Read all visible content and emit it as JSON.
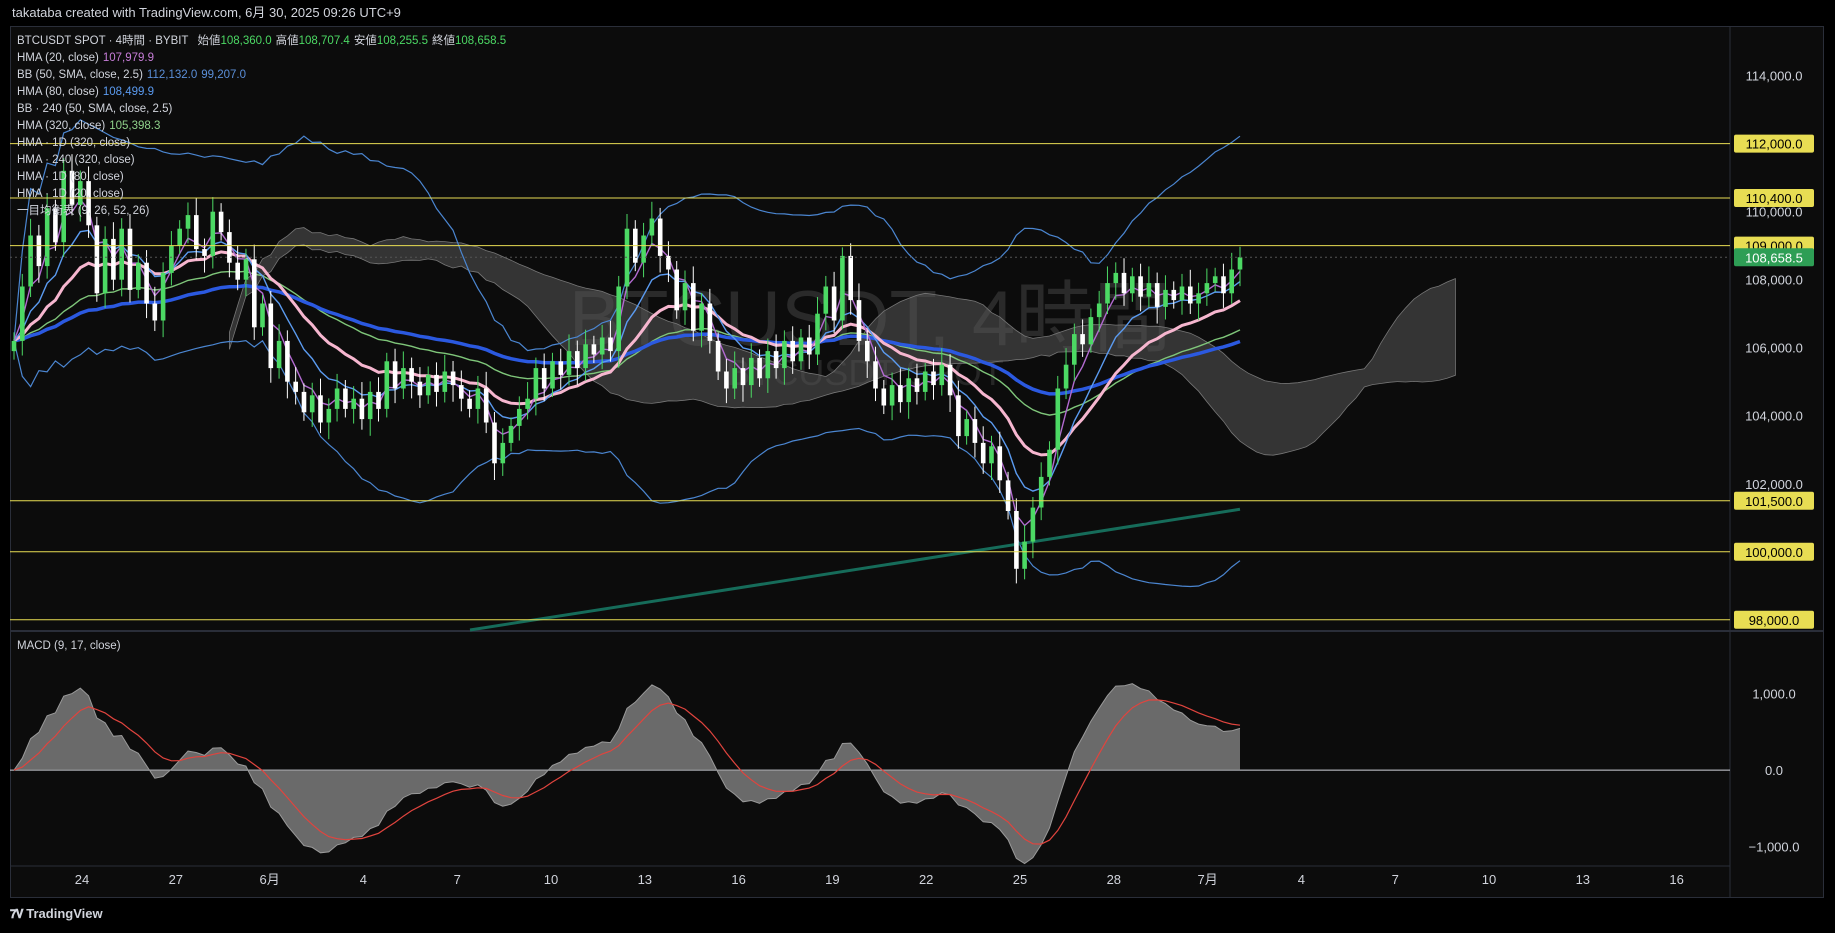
{
  "header": {
    "credit": "takataba created with TradingView.com, 6月 30, 2025 09:26 UTC+9"
  },
  "watermark": {
    "line1": "BTCUSDT, 4時間",
    "line2": "BTCUSDT SPOT"
  },
  "legend": {
    "symbol": "BTCUSDT SPOT · 4時間 · BYBIT",
    "ohlc": [
      {
        "label": "始値",
        "value": "108,360.0"
      },
      {
        "label": "高値",
        "value": "108,707.4"
      },
      {
        "label": "安値",
        "value": "108,255.5"
      },
      {
        "label": "終値",
        "value": "108,658.5"
      }
    ],
    "indicators": [
      {
        "name": "HMA (20, close)",
        "value": "107,979.9",
        "color": "#c77dd8"
      },
      {
        "name": "BB (50, SMA, close, 2.5)",
        "value": "112,132.0",
        "value2": "99,207.0",
        "color": "#5b8fd9"
      },
      {
        "name": "HMA (80, close)",
        "value": "108,499.9",
        "color": "#5b9bf0"
      },
      {
        "name": "BB · 240 (50, SMA, close, 2.5)",
        "value": "",
        "color": "#d1d4dc"
      },
      {
        "name": "HMA (320, close)",
        "value": "105,398.3",
        "color": "#8fd18a"
      },
      {
        "name": "HMA · 1D (320, close)",
        "value": "",
        "color": "#d1d4dc"
      },
      {
        "name": "HMA · 240 (320, close)",
        "value": "",
        "color": "#d1d4dc"
      },
      {
        "name": "HMA · 1D (80, close)",
        "value": "",
        "color": "#d1d4dc"
      },
      {
        "name": "HMA · 1D (20, close)",
        "value": "",
        "color": "#d1d4dc"
      },
      {
        "name": "一目均衡表 (9, 26, 52, 26)",
        "value": "",
        "color": "#d1d4dc"
      }
    ]
  },
  "macd_label": "MACD (9, 17, close)",
  "price_axis": {
    "ticks": [
      "114,000.0",
      "110,000.0",
      "108,000.0",
      "106,000.0",
      "104,000.0",
      "102,000.0"
    ],
    "levels": [
      {
        "label": "112,000.0",
        "value": 112000
      },
      {
        "label": "110,400.0",
        "value": 110400
      },
      {
        "label": "109,000.0",
        "value": 109000
      },
      {
        "label": "101,500.0",
        "value": 101500
      },
      {
        "label": "100,000.0",
        "value": 100000
      },
      {
        "label": "98,000.0",
        "value": 98000
      }
    ],
    "last_price_label": "108,658.5"
  },
  "macd_axis": {
    "ticks": [
      "1,000.0",
      "0.0",
      "−1,000.0"
    ]
  },
  "time_axis": {
    "labels": [
      "24",
      "27",
      "6月",
      "4",
      "7",
      "10",
      "13",
      "16",
      "19",
      "22",
      "25",
      "28",
      "7月",
      "4",
      "7",
      "10",
      "13",
      "16"
    ]
  },
  "colors": {
    "up": "#4cd964",
    "down": "#ffffff",
    "level": "#e8dd53",
    "hma80": "#2b59e0",
    "hma320": "#7fc67a",
    "hma20": "#b26ad0",
    "bb": "#4b86d1",
    "pink": "#f6b6cf",
    "cloud": "#555555",
    "trend": "#166c5a",
    "last": "#2e9e55"
  },
  "brand": "TradingView",
  "chart_data": {
    "type": "candlestick",
    "title": "BTCUSDT SPOT · 4時間 · BYBIT",
    "series": [
      {
        "name": "BTCUSDT",
        "x_start": "5月22",
        "closes": [
          106200,
          107800,
          109300,
          108400,
          110100,
          109100,
          111200,
          110200,
          110900,
          109600,
          107600,
          109200,
          108000,
          109500,
          107700,
          108500,
          107300,
          106800,
          108200,
          109000,
          109500,
          109900,
          108900,
          108700,
          110000,
          109400,
          108500,
          108000,
          108600,
          106600,
          107300,
          105400,
          106200,
          105000,
          104700,
          104100,
          104600,
          103800,
          104200,
          104800,
          104200,
          104500,
          103900,
          104700,
          104200,
          105600,
          104800,
          105400,
          105000,
          104600,
          105200,
          104700,
          105300,
          104900,
          104500,
          104200,
          104800,
          103800,
          102600,
          103200,
          103700,
          104200,
          104500,
          105400,
          104800,
          105600,
          105200,
          105900,
          105400,
          106100,
          105800,
          106300,
          105900,
          107800,
          109500,
          108500,
          109300,
          109800,
          108700,
          108300,
          107100,
          107900,
          106500,
          107300,
          106200,
          105300,
          104800,
          105400,
          104900,
          105700,
          105100,
          105900,
          105400,
          106200,
          105600,
          106300,
          105800,
          107000,
          107800,
          106800,
          108700,
          107400,
          106200,
          105600,
          104800,
          104300,
          104900,
          104400,
          105100,
          104700,
          105300,
          104900,
          105500,
          104600,
          103400,
          103900,
          103200,
          102600,
          103100,
          102100,
          101200,
          99500,
          100300,
          101300,
          102200,
          103000,
          104800,
          105500,
          106400,
          106100,
          106900,
          107300,
          107900,
          108200,
          107600,
          108100,
          107500,
          107900,
          107200,
          107700,
          107400,
          107800,
          107300,
          107600,
          107900,
          108100,
          107600,
          108300,
          108659
        ]
      }
    ],
    "levels": [
      112000,
      110400,
      109000,
      101500,
      100000,
      98000
    ],
    "price_range": [
      97700,
      115400
    ],
    "macd": {
      "name": "MACD (9, 17, close)",
      "range": [
        -1200,
        1700
      ]
    }
  }
}
